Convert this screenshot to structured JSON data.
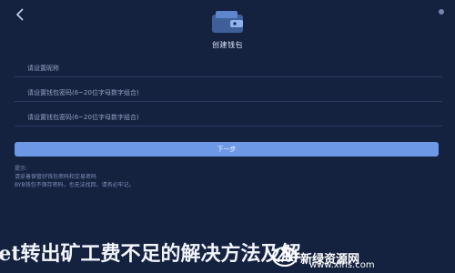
{
  "header": {
    "back_icon": "chevron-left-icon",
    "status_text": "",
    "title": "创建钱包"
  },
  "form": {
    "name_placeholder": "请设置昵称",
    "password_placeholder": "请设置钱包密码(6~20位字母数字组合)",
    "confirm_placeholder": "请设置钱包密码(6~20位字母数字组合)"
  },
  "actions": {
    "next_label": "下一步"
  },
  "notes": [
    "提示:",
    "请妥善保管好钱包密码和交易密码",
    "BYB钱包不保存密码，也无法找回，请务必牢记。"
  ],
  "banner": {
    "text": "let转出矿工费不足的解决方法及解"
  },
  "watermark": {
    "site": "新绿资源网",
    "url": "www.xlhs.com"
  },
  "colors": {
    "background": "#14213f",
    "button": "#6d98e6"
  }
}
